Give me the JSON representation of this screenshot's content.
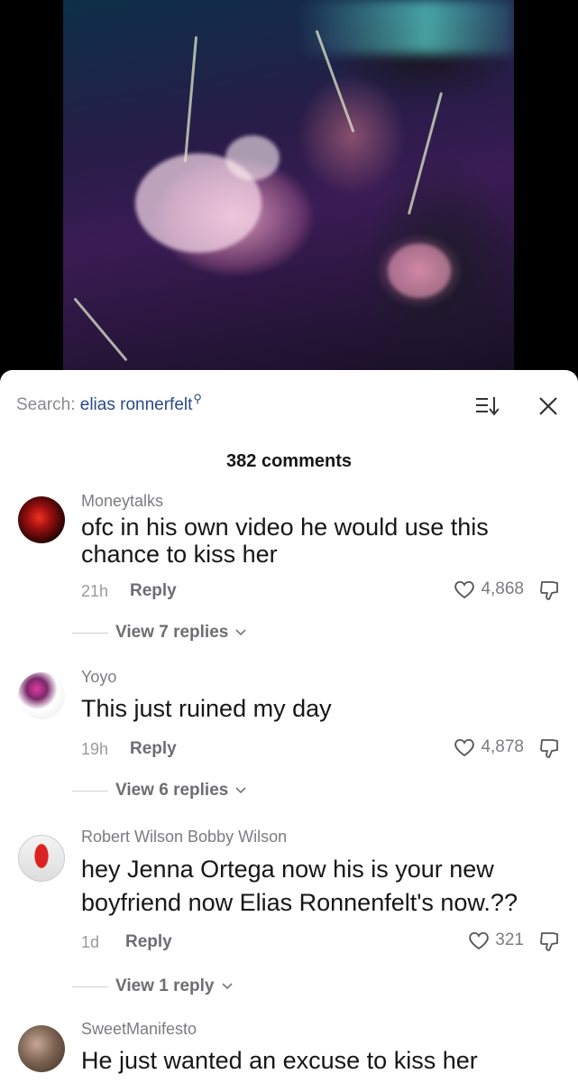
{
  "search": {
    "prefix": "Search:",
    "query": "elias ronnerfelt",
    "icon": "search-icon"
  },
  "header": {
    "count_label": "382 comments",
    "sort_icon": "sort-icon",
    "close_icon": "close-icon"
  },
  "comments": [
    {
      "username": "Moneytalks",
      "text": "ofc in his own video he would use this chance to kiss her",
      "time": "21h",
      "reply": "Reply",
      "likes": "4,868",
      "view_replies": "View 7 replies",
      "avatar_color": "#8a1010"
    },
    {
      "username": "Yoyo",
      "text": "This just ruined my day",
      "time": "19h",
      "reply": "Reply",
      "likes": "4,878",
      "view_replies": "View 6 replies",
      "avatar_color": "#2b1e2e"
    },
    {
      "username": "Robert Wilson Bobby Wilson",
      "text": "hey Jenna Ortega now his is your new boyfriend now Elias Ronnenfelt's now.??",
      "time": "1d",
      "reply": "Reply",
      "likes": "321",
      "view_replies": "View 1 reply",
      "avatar_color": "#d33"
    },
    {
      "username": "SweetManifesto",
      "text": "He just wanted an excuse to kiss her",
      "avatar_color": "#8a7b6a"
    }
  ]
}
